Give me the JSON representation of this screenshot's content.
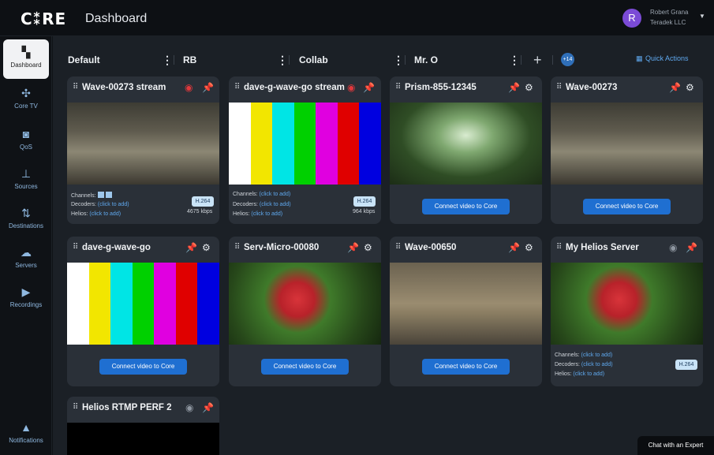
{
  "app": {
    "logo": "C⁑RE",
    "title": "Dashboard"
  },
  "user": {
    "initial": "R",
    "name": "Robert Grana",
    "org": "Teradek LLC"
  },
  "nav": [
    {
      "label": "Dashboard",
      "icon": "dashboard-icon",
      "glyph": "▚",
      "active": true
    },
    {
      "label": "Core TV",
      "icon": "core-tv-icon",
      "glyph": "✣"
    },
    {
      "label": "QoS",
      "icon": "qos-icon",
      "glyph": "◙"
    },
    {
      "label": "Sources",
      "icon": "sources-icon",
      "glyph": "⊥"
    },
    {
      "label": "Destinations",
      "icon": "destinations-icon",
      "glyph": "⇅"
    },
    {
      "label": "Servers",
      "icon": "servers-icon",
      "glyph": "☁"
    },
    {
      "label": "Recordings",
      "icon": "recordings-icon",
      "glyph": "▶"
    },
    {
      "label": "Notifications",
      "icon": "bell-icon",
      "glyph": "▲"
    }
  ],
  "columns": {
    "default": "Default",
    "rb": "RB",
    "collab": "Collab",
    "mro": "Mr. O"
  },
  "more_badge": "+14",
  "quick_actions": "Quick Actions",
  "connect_label": "Connect video to Core",
  "meta": {
    "channels": "Channels:",
    "decoders": "Decoders:",
    "helios": "Helios:",
    "click": "(click to add)"
  },
  "cards": [
    {
      "title": "Wave-00273 stream",
      "codec": "H.264",
      "kbps": "4675 kbps"
    },
    {
      "title": "dave-g-wave-go stream",
      "codec": "H.264",
      "kbps": "964 kbps"
    },
    {
      "title": "Prism-855-12345"
    },
    {
      "title": "Wave-00273"
    },
    {
      "title": "dave-g-wave-go"
    },
    {
      "title": "Serv-Micro-00080"
    },
    {
      "title": "Wave-00650"
    },
    {
      "title": "My Helios Server",
      "codec": "H.264"
    },
    {
      "title": "Helios RTMP PERF 2"
    }
  ],
  "chat": "Chat with an Expert",
  "colors": {
    "accent": "#1f6fd1",
    "record": "#e0383c",
    "card": "#2a3038"
  }
}
